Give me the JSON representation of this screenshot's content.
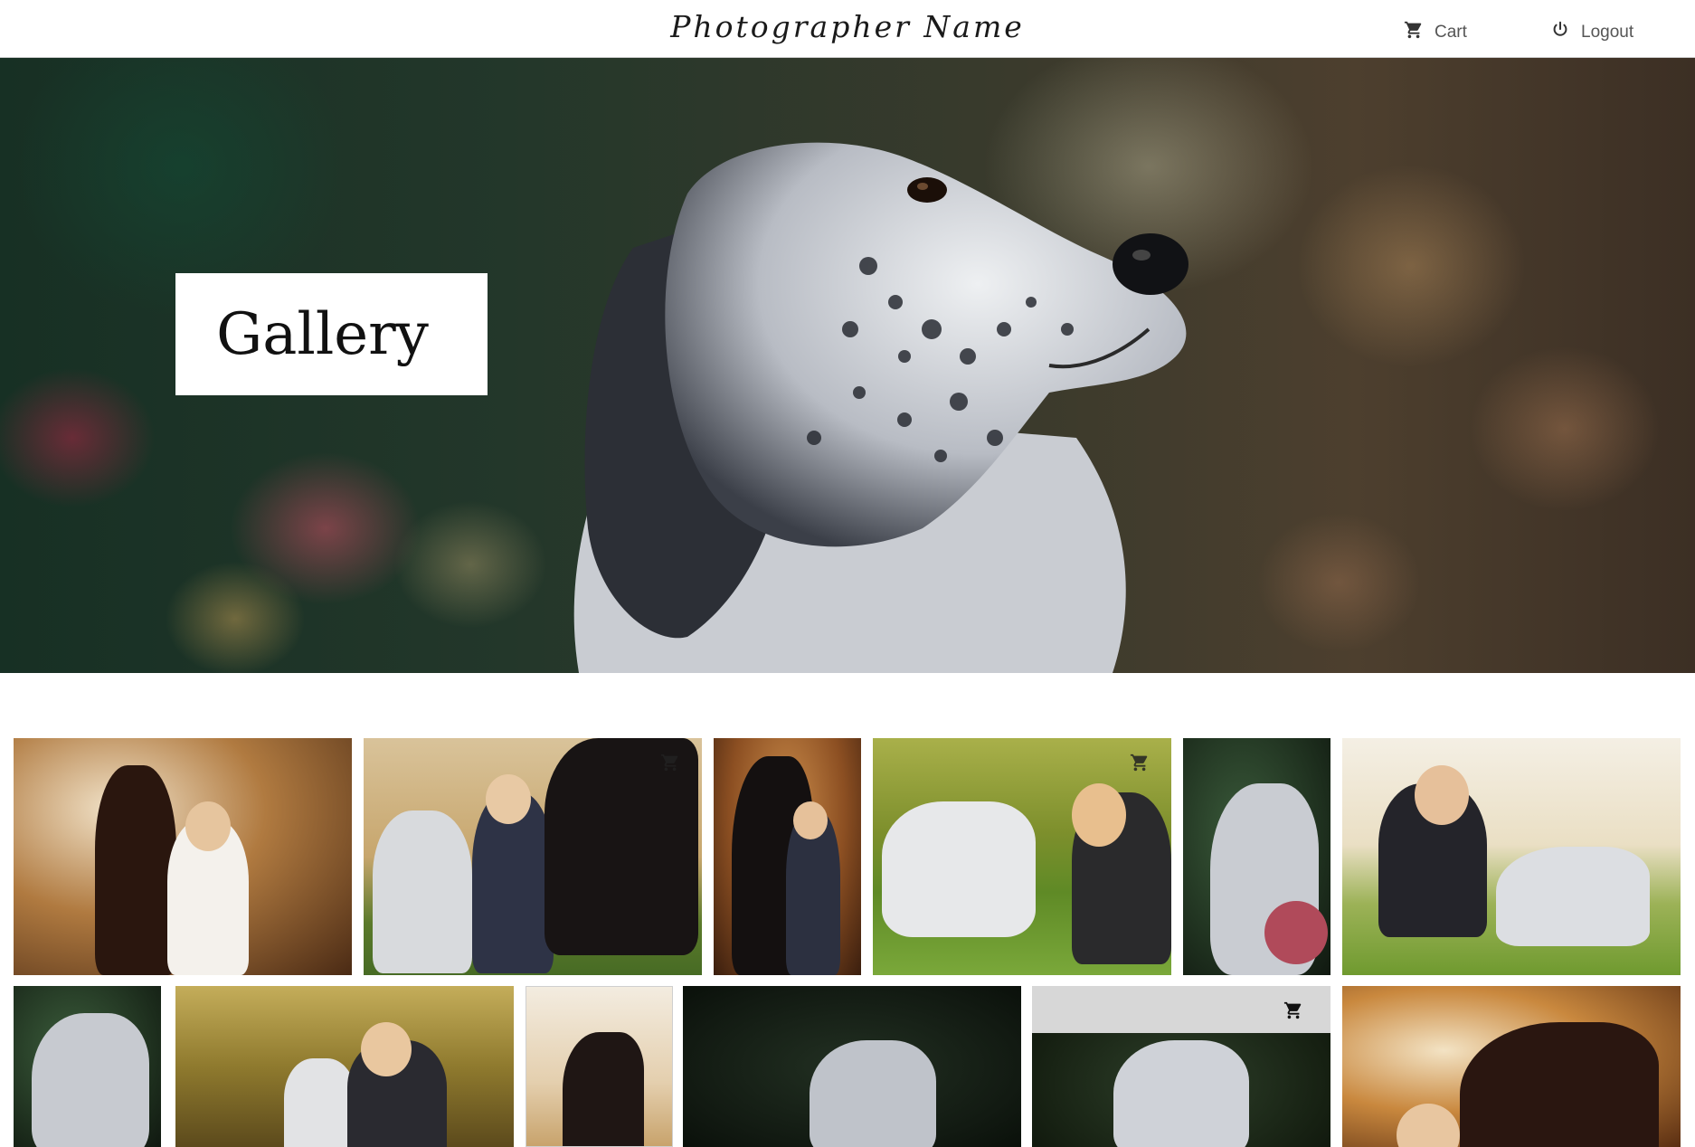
{
  "header": {
    "brand": "Photographer Name",
    "cart_label": "Cart",
    "logout_label": "Logout",
    "icons": {
      "cart": "cart-icon",
      "logout": "power-icon"
    }
  },
  "hero": {
    "title": "Gallery",
    "subject": "english-setter-portrait"
  },
  "gallery": {
    "rows": [
      [
        {
          "subject": "woman-with-dark-horse",
          "cart_icon_visible": false
        },
        {
          "subject": "woman-dog-and-horse",
          "cart_icon_visible": true
        },
        {
          "subject": "girl-with-black-horse",
          "cart_icon_visible": false
        },
        {
          "subject": "girl-lying-with-setter",
          "cart_icon_visible": true
        },
        {
          "subject": "setter-with-flowers",
          "cart_icon_visible": false
        },
        {
          "subject": "woman-crouching-with-setter",
          "cart_icon_visible": false
        }
      ],
      [
        {
          "subject": "setter-portrait",
          "cart_icon_visible": false
        },
        {
          "subject": "girl-hugging-setter",
          "cart_icon_visible": false
        },
        {
          "subject": "black-foal",
          "cart_icon_visible": false
        },
        {
          "subject": "setter-in-dark-forest",
          "cart_icon_visible": false
        },
        {
          "subject": "setter-hover-selected",
          "cart_icon_visible": true
        },
        {
          "subject": "girl-kissing-horse",
          "cart_icon_visible": false
        }
      ]
    ]
  },
  "colors": {
    "header_border": "#cfcfcf",
    "nav_text": "#555555",
    "hover_bar": "#d7d7d7"
  }
}
